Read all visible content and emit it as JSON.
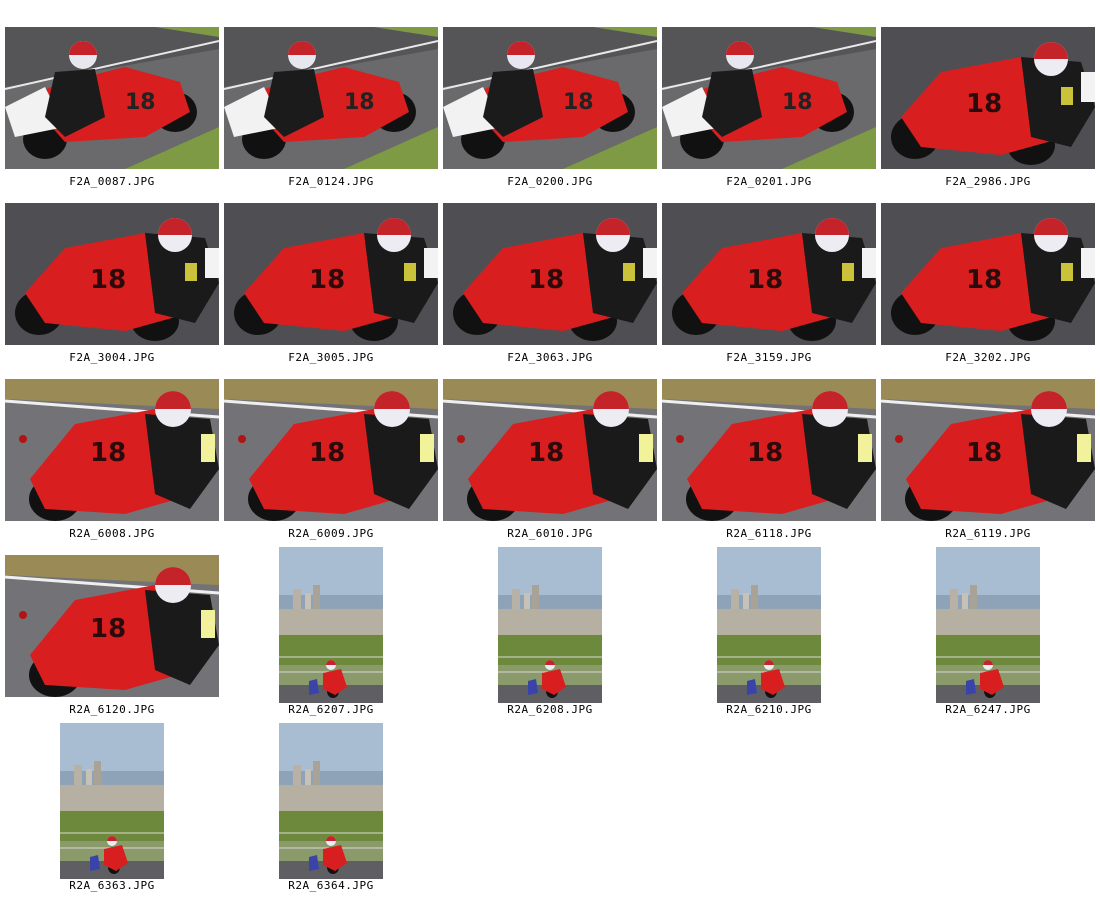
{
  "gallery": {
    "items": [
      {
        "filename": "F2A_0087.JPG",
        "orientation": "landscape",
        "variant": "wide-left"
      },
      {
        "filename": "F2A_0124.JPG",
        "orientation": "landscape",
        "variant": "wide-left"
      },
      {
        "filename": "F2A_0200.JPG",
        "orientation": "landscape",
        "variant": "wide-left"
      },
      {
        "filename": "F2A_0201.JPG",
        "orientation": "landscape",
        "variant": "wide-left"
      },
      {
        "filename": "F2A_2986.JPG",
        "orientation": "landscape",
        "variant": "close-right"
      },
      {
        "filename": "F2A_3004.JPG",
        "orientation": "landscape",
        "variant": "close-right"
      },
      {
        "filename": "F2A_3005.JPG",
        "orientation": "landscape",
        "variant": "close-right"
      },
      {
        "filename": "F2A_3063.JPG",
        "orientation": "landscape",
        "variant": "close-right"
      },
      {
        "filename": "F2A_3159.JPG",
        "orientation": "landscape",
        "variant": "close-right"
      },
      {
        "filename": "F2A_3202.JPG",
        "orientation": "landscape",
        "variant": "close-right"
      },
      {
        "filename": "R2A_6008.JPG",
        "orientation": "landscape",
        "variant": "grass-right"
      },
      {
        "filename": "R2A_6009.JPG",
        "orientation": "landscape",
        "variant": "grass-right"
      },
      {
        "filename": "R2A_6010.JPG",
        "orientation": "landscape",
        "variant": "grass-right"
      },
      {
        "filename": "R2A_6118.JPG",
        "orientation": "landscape",
        "variant": "grass-right"
      },
      {
        "filename": "R2A_6119.JPG",
        "orientation": "landscape",
        "variant": "grass-right"
      },
      {
        "filename": "R2A_6120.JPG",
        "orientation": "landscape",
        "variant": "grass-right"
      },
      {
        "filename": "R2A_6207.JPG",
        "orientation": "portrait",
        "variant": "city"
      },
      {
        "filename": "R2A_6208.JPG",
        "orientation": "portrait",
        "variant": "city"
      },
      {
        "filename": "R2A_6210.JPG",
        "orientation": "portrait",
        "variant": "city"
      },
      {
        "filename": "R2A_6247.JPG",
        "orientation": "portrait",
        "variant": "city"
      },
      {
        "filename": "R2A_6363.JPG",
        "orientation": "portrait",
        "variant": "city"
      },
      {
        "filename": "R2A_6364.JPG",
        "orientation": "portrait",
        "variant": "city"
      }
    ]
  },
  "colors": {
    "bike_red": "#d81e1e",
    "track_grey": "#5b5b5f",
    "grass_green": "#7f9a45",
    "sky_blue": "#a8bdd2"
  }
}
